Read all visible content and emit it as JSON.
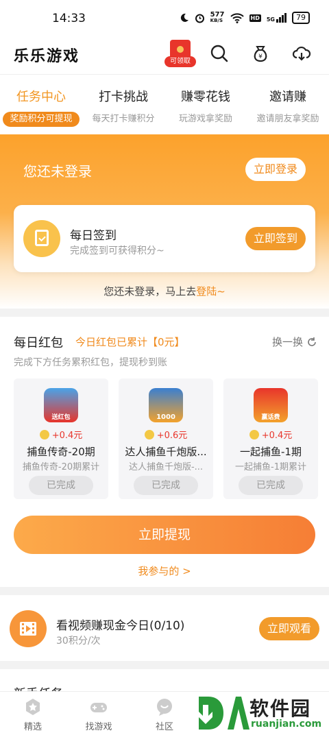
{
  "status_bar": {
    "time": "14:33",
    "net_speed": "577",
    "net_unit": "KB/S",
    "hd": "HD",
    "signal": "5G",
    "battery": "79"
  },
  "app": {
    "title": "乐乐游戏",
    "redpacket_tag": "可领取"
  },
  "tabs": [
    {
      "title": "任务中心",
      "subtitle": "奖励积分可提现",
      "active": true
    },
    {
      "title": "打卡挑战",
      "subtitle": "每天打卡赚积分",
      "active": false
    },
    {
      "title": "赚零花钱",
      "subtitle": "玩游戏拿奖励",
      "active": false
    },
    {
      "title": "邀请赚",
      "subtitle": "邀请朋友拿奖励",
      "active": false
    }
  ],
  "hero": {
    "login_tip": "您还未登录",
    "login_button": "立即登录",
    "sign_title": "每日签到",
    "sign_subtitle": "完成签到可获得积分~",
    "sign_button": "立即签到",
    "hint_prefix": "您还未登录，马上去",
    "hint_link": "登陆~"
  },
  "daily_redpacket": {
    "title": "每日红包",
    "total": "今日红包已累计【0元】",
    "swap": "换一换",
    "subtitle": "完成下方任务累积红包，提现秒到账",
    "games": [
      {
        "reward": "+0.4元",
        "name": "捕鱼传奇-20期",
        "desc": "捕鱼传奇-20期累计",
        "status": "已完成",
        "logo_text": "送红包"
      },
      {
        "reward": "+0.6元",
        "name": "达人捕鱼千炮版...",
        "desc": "达人捕鱼千炮版-...",
        "status": "已完成",
        "logo_text": "1000"
      },
      {
        "reward": "+0.4元",
        "name": "一起捕鱼-1期",
        "desc": "一起捕鱼-1期累计",
        "status": "已完成",
        "logo_text": "赢话费"
      }
    ],
    "withdraw_button": "立即提现",
    "my_participation": "我参与的 >"
  },
  "video_task": {
    "title": "看视频赚现金今日(0/10)",
    "subtitle": "30积分/次",
    "button": "立即观看"
  },
  "new_tasks": {
    "title": "新手任务"
  },
  "bottom_nav": [
    {
      "label": "精选"
    },
    {
      "label": "找游戏"
    },
    {
      "label": "社区"
    }
  ],
  "watermark": {
    "logo_text": "DA",
    "cn": "软件园",
    "en": "ruanjian.com"
  },
  "colors": {
    "accent": "#f08a1c",
    "button": "#f29b2b",
    "reward_red": "#e8352b"
  }
}
